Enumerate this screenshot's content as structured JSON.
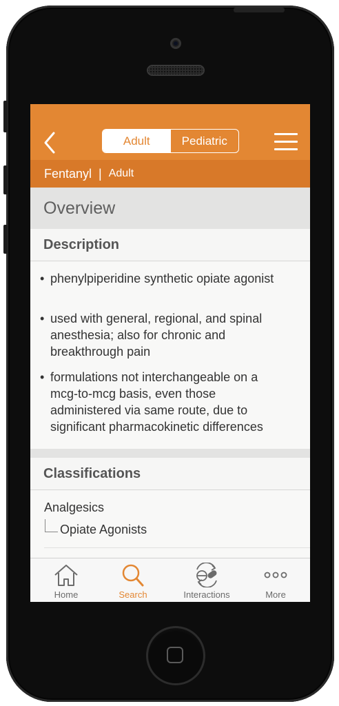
{
  "nav": {
    "segment_adult": "Adult",
    "segment_pediatric": "Pediatric"
  },
  "subheader": {
    "drug": "Fentanyl",
    "separator": "|",
    "population": "Adult"
  },
  "overview_title": "Overview",
  "description": {
    "title": "Description",
    "bullets": [
      "phenylpiperidine synthetic opiate agonist",
      "used with general, regional, and spinal anesthesia; also for chronic and breakthrough pain",
      "formulations not interchangeable on a mcg-to-mcg basis, even those administered via same route, due to significant pharmacokinetic differences"
    ]
  },
  "classifications": {
    "title": "Classifications",
    "root": "Analgesics",
    "child": "Opiate Agonists"
  },
  "tabbar": {
    "tabs": [
      {
        "label": "Home",
        "icon": "home-icon"
      },
      {
        "label": "Search",
        "icon": "search-icon"
      },
      {
        "label": "Interactions",
        "icon": "interactions-icon"
      },
      {
        "label": "More",
        "icon": "more-icon"
      }
    ],
    "active": "Search"
  },
  "colors": {
    "accent": "#e38733",
    "subbar": "#d87929"
  }
}
